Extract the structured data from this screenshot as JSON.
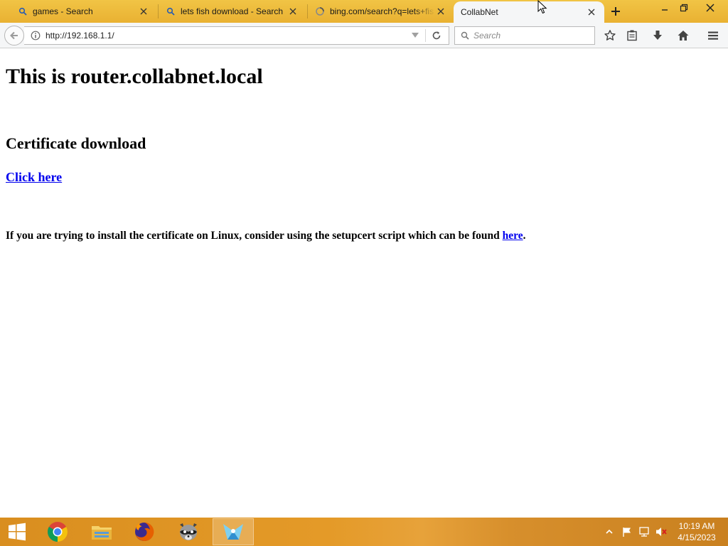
{
  "browser": {
    "tabs": [
      {
        "label": "games - Search",
        "icon": "search-icon"
      },
      {
        "label": "lets fish download - Search",
        "icon": "search-icon"
      },
      {
        "label": "bing.com/search?q=lets+fis",
        "icon": "loading-icon"
      },
      {
        "label": "CollabNet",
        "icon": ""
      }
    ],
    "active_tab_index": 3
  },
  "navbar": {
    "url": "http://192.168.1.1/",
    "search_placeholder": "Search"
  },
  "page": {
    "heading": "This is router.collabnet.local",
    "subheading": "Certificate download",
    "cert_link": "Click here",
    "linux_note": "If you are trying to install the certificate on Linux, consider using the setupcert script which can be found ",
    "linux_link": "here",
    "linux_note_end": "."
  },
  "taskbar": {
    "apps": [
      "chrome-icon",
      "file-explorer-icon",
      "firefox-icon",
      "raccoon-app-icon",
      "pinned-app-icon"
    ],
    "time": "10:19 AM",
    "date": "4/15/2023"
  },
  "colors": {
    "tabstrip": "#f1c445",
    "link": "#0000ee",
    "taskbar": "#e49a28"
  }
}
